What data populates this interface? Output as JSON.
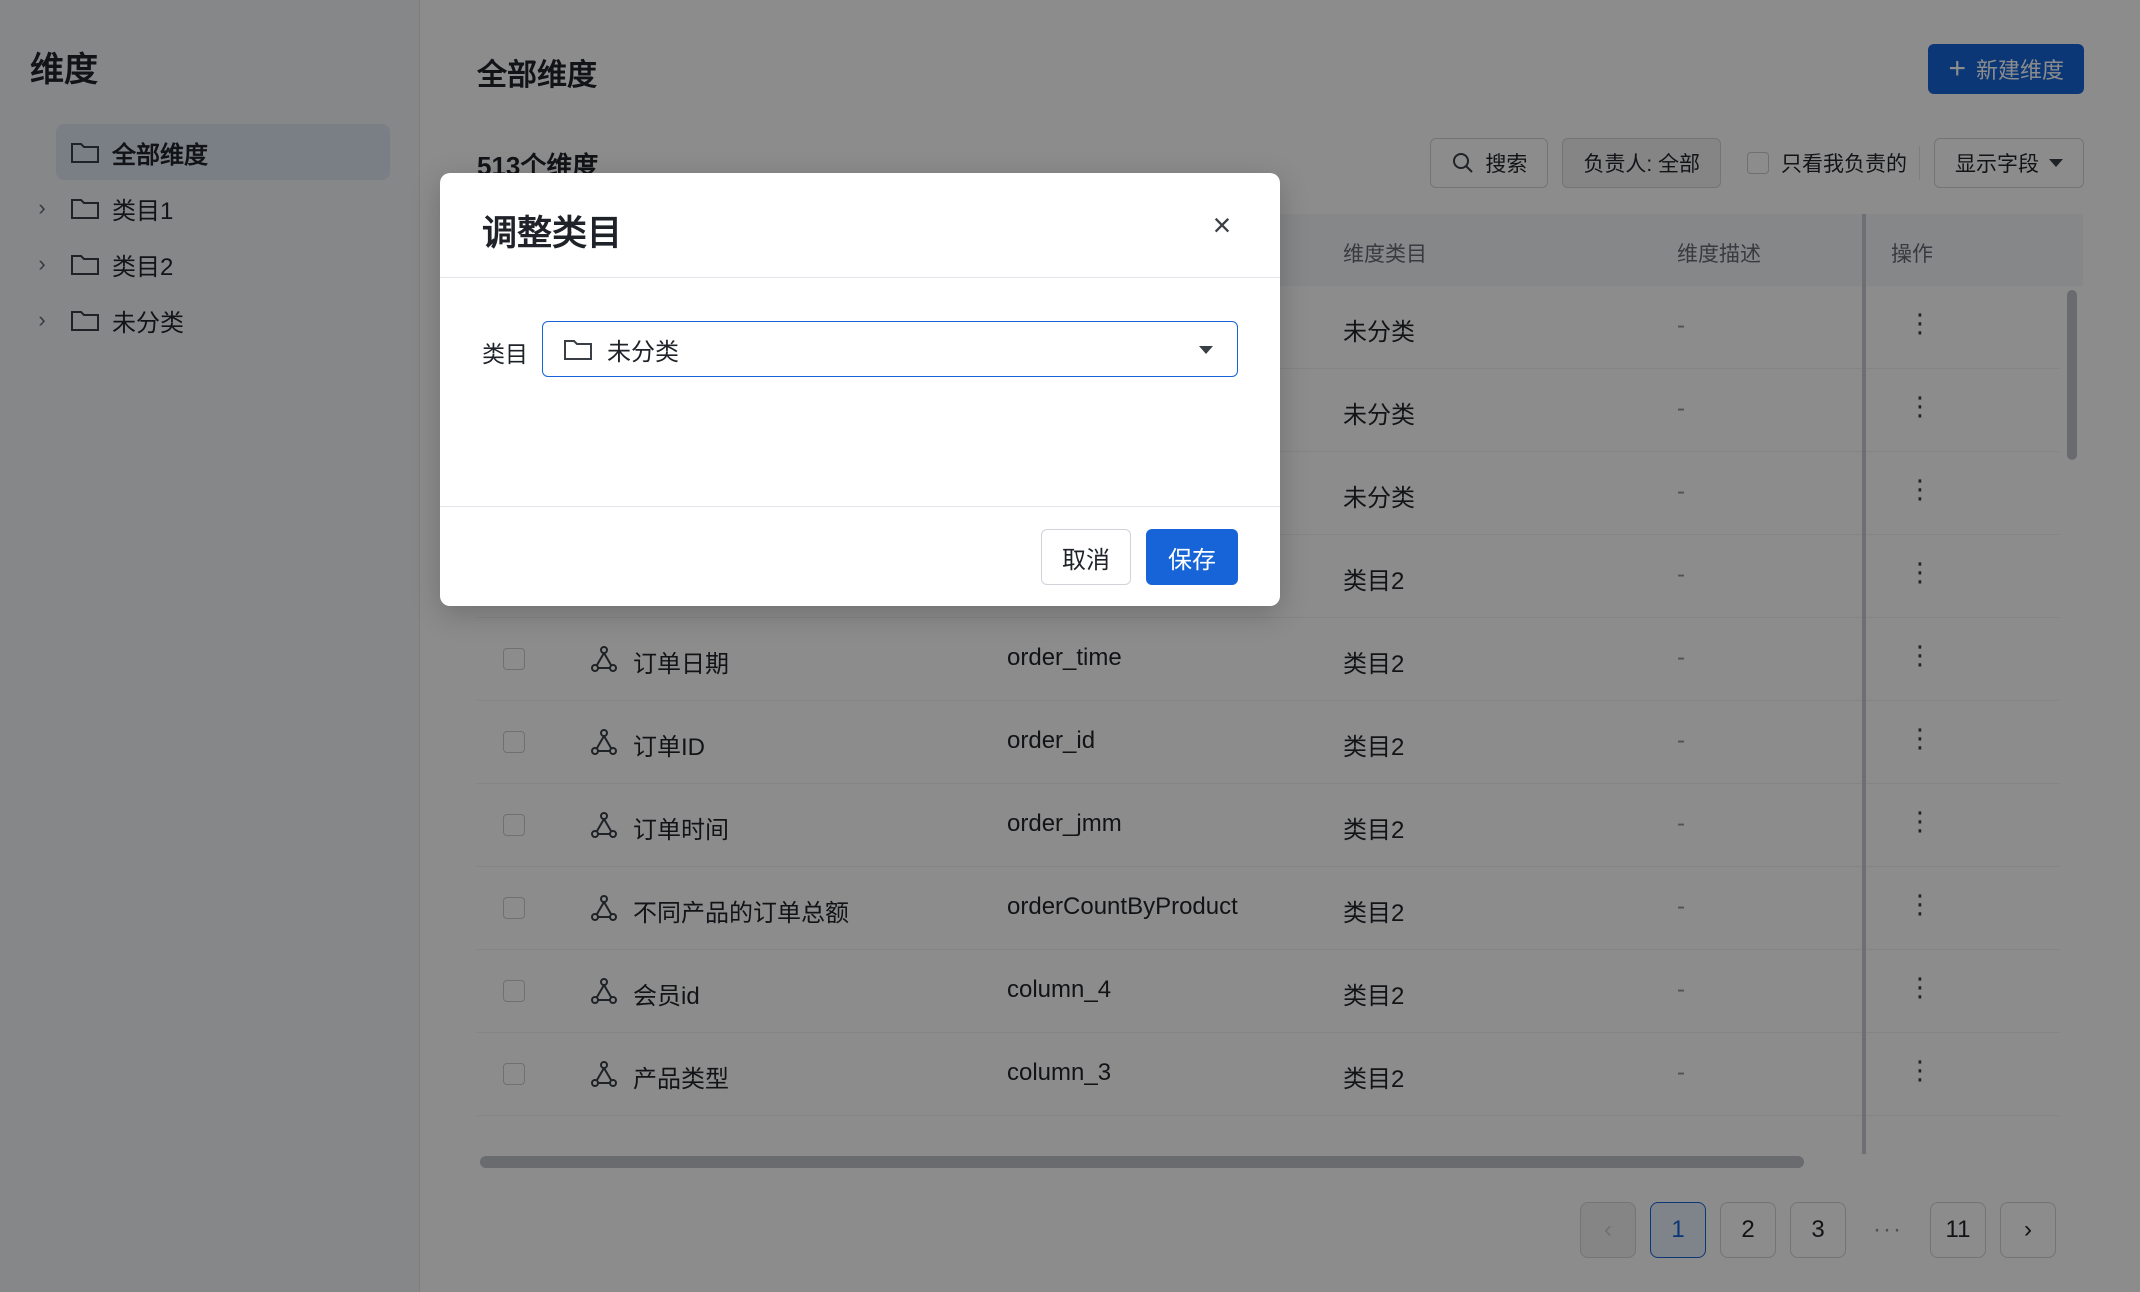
{
  "sidebar": {
    "title": "维度",
    "items": [
      {
        "label": "全部维度",
        "active": true,
        "expandable": false
      },
      {
        "label": "类目1",
        "active": false,
        "expandable": true
      },
      {
        "label": "类目2",
        "active": false,
        "expandable": true
      },
      {
        "label": "未分类",
        "active": false,
        "expandable": true
      }
    ]
  },
  "main": {
    "title": "全部维度",
    "new_button": "新建维度",
    "count": "513个维度",
    "toolbar": {
      "search": "搜索",
      "owner_filter": "负责人: 全部",
      "only_mine": "只看我负责的",
      "show_fields": "显示字段"
    },
    "table": {
      "headers": {
        "category": "维度类目",
        "description": "维度描述",
        "actions": "操作"
      },
      "rows": [
        {
          "name": "",
          "field": "",
          "category": "未分类",
          "description": "-"
        },
        {
          "name": "",
          "field": "",
          "category": "未分类",
          "description": "-"
        },
        {
          "name": "",
          "field": "",
          "category": "未分类",
          "description": "-"
        },
        {
          "name": "",
          "field": "",
          "category": "类目2",
          "description": "-"
        },
        {
          "name": "订单日期",
          "field": "order_time",
          "category": "类目2",
          "description": "-"
        },
        {
          "name": "订单ID",
          "field": "order_id",
          "category": "类目2",
          "description": "-"
        },
        {
          "name": "订单时间",
          "field": "order_jmm",
          "category": "类目2",
          "description": "-"
        },
        {
          "name": "不同产品的订单总额",
          "field": "orderCountByProduct",
          "category": "类目2",
          "description": "-"
        },
        {
          "name": "会员id",
          "field": "column_4",
          "category": "类目2",
          "description": "-"
        },
        {
          "name": "产品类型",
          "field": "column_3",
          "category": "类目2",
          "description": "-"
        }
      ]
    },
    "pagination": {
      "pages": [
        "1",
        "2",
        "3",
        "···",
        "11"
      ],
      "current": "1"
    }
  },
  "modal": {
    "title": "调整类目",
    "field_label": "类目",
    "selected_value": "未分类",
    "cancel": "取消",
    "save": "保存"
  },
  "colors": {
    "primary": "#1664d7",
    "mask": "rgba(0,0,0,0.45)",
    "sidebar_active": "#dfe7f4"
  }
}
